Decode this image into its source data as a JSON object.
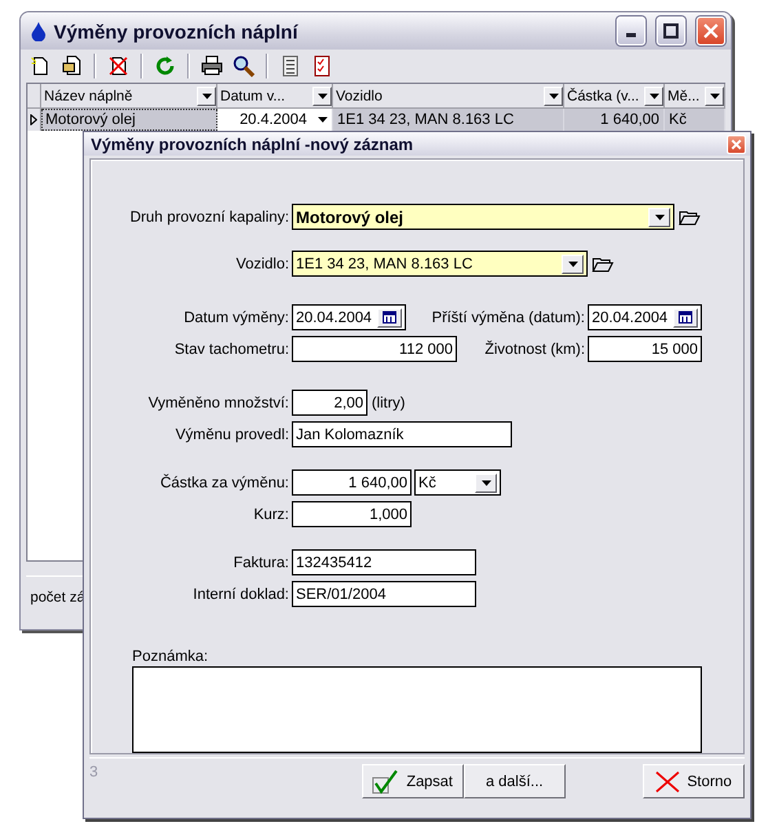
{
  "main_window": {
    "title": "Výměny provozních náplní",
    "columns": [
      "Název náplně",
      "Datum v...",
      "Vozidlo",
      "Částka (v...",
      "Mě..."
    ],
    "rows": [
      {
        "cells": [
          "Motorový olej",
          "20.4.2004",
          "1E1 34 23, MAN 8.163 LC",
          "1 640,00",
          "Kč"
        ],
        "selected": true
      }
    ],
    "status": "počet zá"
  },
  "dialog": {
    "title": "Výměny provozních náplní -nový záznam",
    "fluid_type": {
      "label": "Druh provozní kapaliny:",
      "value": "Motorový olej"
    },
    "vehicle": {
      "label": "Vozidlo:",
      "value": "1E1 34 23, MAN 8.163 LC"
    },
    "change_date": {
      "label": "Datum výměny:",
      "value": "20.04.2004"
    },
    "next_change_date": {
      "label": "Příští výměna (datum):",
      "value": "20.04.2004"
    },
    "odometer": {
      "label": "Stav tachometru:",
      "value": "112 000"
    },
    "lifetime": {
      "label": "Životnost (km):",
      "value": "15 000"
    },
    "quantity": {
      "label": "Vyměněno množství:",
      "value": "2,00",
      "unit": "(litry)"
    },
    "performed_by": {
      "label": "Výměnu provedl:",
      "value": "Jan Kolomazník"
    },
    "amount": {
      "label": "Částka za výměnu:",
      "value": "1 640,00",
      "currency": "Kč"
    },
    "rate": {
      "label": "Kurz:",
      "value": "1,000"
    },
    "invoice": {
      "label": "Faktura:",
      "value": "132435412"
    },
    "internal_doc": {
      "label": "Interní doklad:",
      "value": "SER/01/2004"
    },
    "note": {
      "label": "Poznámka:"
    },
    "status": "3",
    "buttons": [
      {
        "label": "Zapsat",
        "kind": "ok"
      },
      {
        "label": "a další...",
        "kind": "plain"
      },
      {
        "label": "Storno",
        "kind": "cancel"
      }
    ]
  }
}
